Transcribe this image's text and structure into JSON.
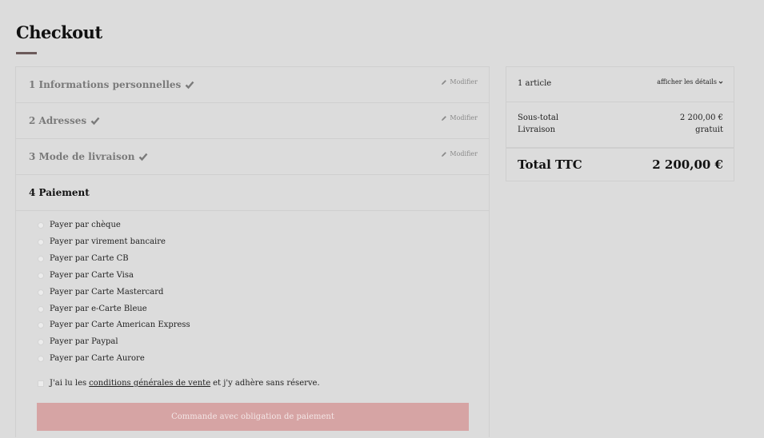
{
  "page": {
    "title": "Checkout"
  },
  "steps": [
    {
      "label": "1 Informations personnelles",
      "edit": "Modifier"
    },
    {
      "label": "2 Adresses",
      "edit": "Modifier"
    },
    {
      "label": "3 Mode de livraison",
      "edit": "Modifier"
    },
    {
      "label": "4 Paiement"
    }
  ],
  "payment": {
    "options": [
      "Payer par chèque",
      "Payer par virement bancaire",
      "Payer par Carte CB",
      "Payer par Carte Visa",
      "Payer par Carte Mastercard",
      "Payer par e-Carte Bleue",
      "Payer par Carte American Express",
      "Payer par Paypal",
      "Payer par Carte Aurore"
    ],
    "terms_prefix": "J'ai lu les",
    "terms_link": "conditions générales de vente",
    "terms_suffix": "et j'y adhère sans réserve.",
    "submit_label": "Commande avec obligation de paiement"
  },
  "summary": {
    "article_count": "1 article",
    "details_link": "afficher les détails",
    "subtotal_label": "Sous-total",
    "subtotal_value": "2 200,00 €",
    "shipping_label": "Livraison",
    "shipping_value": "gratuit",
    "total_label": "Total TTC",
    "total_value": "2 200,00 €"
  },
  "colors": {
    "background": "#dcdcdc",
    "button": "#d6a4a4",
    "accent_underline": "#6b5a5a"
  }
}
